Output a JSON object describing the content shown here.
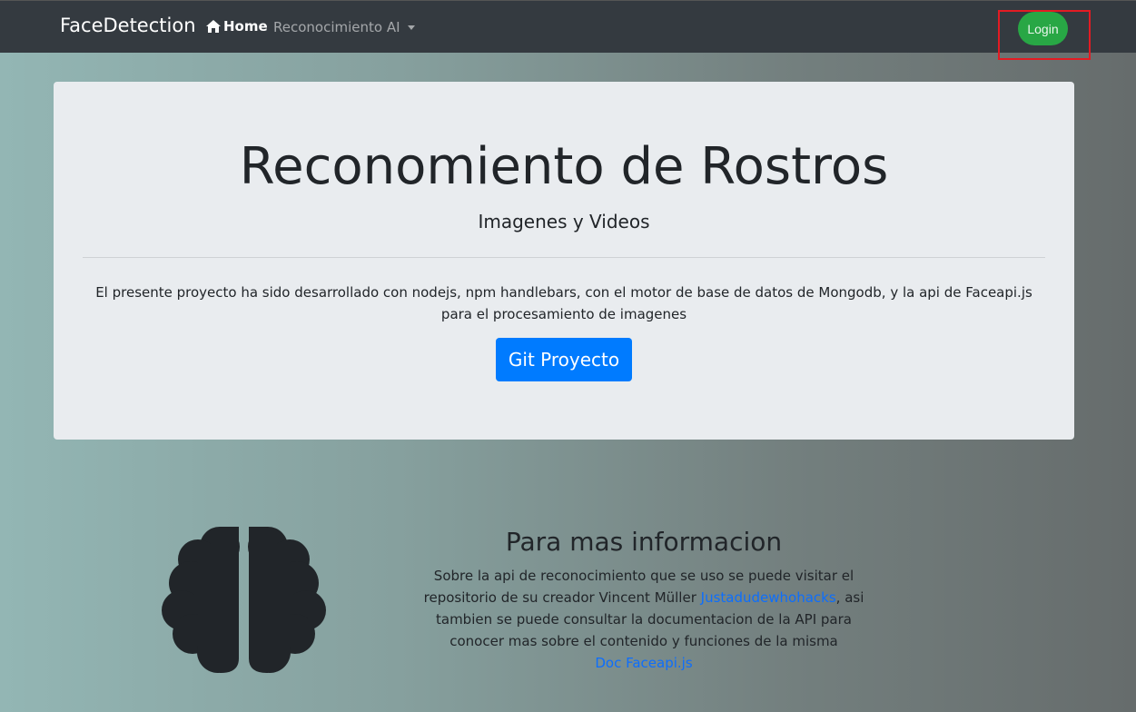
{
  "navbar": {
    "brand": "FaceDetection",
    "home_label": "Home",
    "dropdown_label": "Reconocimiento AI",
    "login_label": "Login"
  },
  "jumbotron": {
    "title": "Reconomiento de Rostros",
    "subtitle": "Imagenes y Videos",
    "description": "El presente proyecto ha sido desarrollado con nodejs, npm handlebars, con el motor de base de datos de Mongodb, y la api de Faceapi.js para el procesamiento de imagenes",
    "button_label": "Git Proyecto"
  },
  "info": {
    "title": "Para mas informacion",
    "text_before_link": "Sobre la api de reconocimiento que se uso se puede visitar el repositorio de su creador Vincent Müller ",
    "author_link": "Justadudewhohacks",
    "text_after_link": ", asi tambien se puede consultar la documentacion de la API para conocer mas sobre el contenido y funciones de la misma",
    "doc_link": "Doc Faceapi.js"
  },
  "icons": {
    "home": "home-icon",
    "brain": "brain-icon",
    "dropdown": "caret-down-icon"
  },
  "colors": {
    "navbar_bg": "#343a40",
    "login_green": "#28a745",
    "primary_blue": "#007bff",
    "highlight_red": "#e31b23"
  }
}
